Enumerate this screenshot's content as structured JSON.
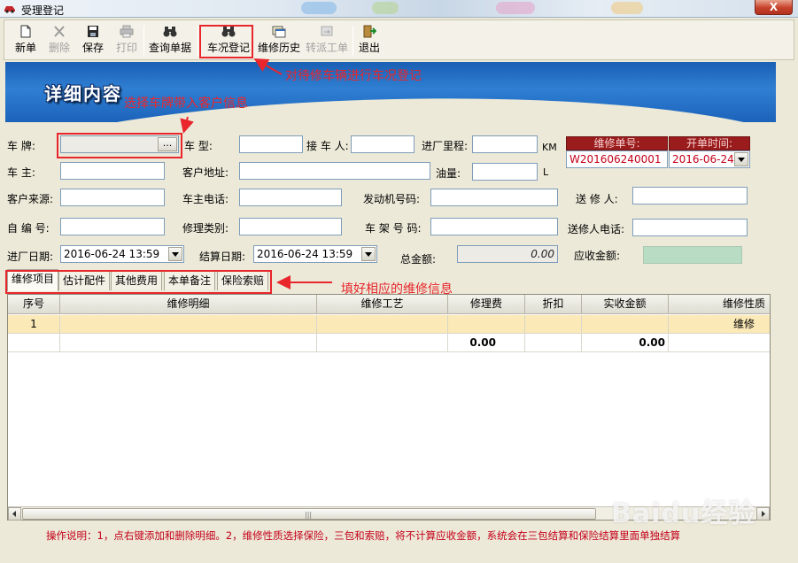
{
  "window": {
    "title": "受理登记",
    "close": "X"
  },
  "toolbar": {
    "new": "新单",
    "delete": "删除",
    "save": "保存",
    "print": "打印",
    "query": "查询单据",
    "vehicle_check": "车况登记",
    "history": "维修历史",
    "dispatch": "转派工单",
    "exit": "退出"
  },
  "banner": {
    "title": "详细内容"
  },
  "form": {
    "plate": {
      "label": "车    牌:",
      "value": "",
      "button": "..."
    },
    "model": {
      "label": "车    型:",
      "value": ""
    },
    "receiver": {
      "label": "接 车 人:",
      "value": ""
    },
    "mileage": {
      "label": "进厂里程:",
      "value": "",
      "unit": "KM"
    },
    "owner": {
      "label": "车    主:",
      "value": ""
    },
    "address": {
      "label": "客户地址:",
      "value": ""
    },
    "fuel": {
      "label": "油量:",
      "value": "",
      "unit": "L"
    },
    "source": {
      "label": "客户来源:",
      "value": ""
    },
    "owner_phone": {
      "label": "车主电话:",
      "value": ""
    },
    "engine_no": {
      "label": "发动机号码:",
      "value": ""
    },
    "sender": {
      "label": "送 修 人:",
      "value": ""
    },
    "self_no": {
      "label": "自 编 号:",
      "value": ""
    },
    "repair_type": {
      "label": "修理类别:",
      "value": ""
    },
    "frame_no": {
      "label": "车 架 号 码:",
      "value": ""
    },
    "sender_phone": {
      "label": "送修人电话:",
      "value": ""
    },
    "entry_date": {
      "label": "进厂日期:",
      "value": "2016-06-24 13:59"
    },
    "settle_date": {
      "label": "结算日期:",
      "value": "2016-06-24 13:59"
    },
    "total": {
      "label": "总金额:",
      "value": "0.00"
    },
    "receivable": {
      "label": "应收金额:",
      "value": ""
    }
  },
  "order": {
    "no_label": "维修单号:",
    "no_value": "W201606240001",
    "time_label": "开单时间:",
    "time_value": "2016-06-24"
  },
  "tabs": [
    "维修项目",
    "估计配件",
    "其他费用",
    "本单备注",
    "保险索赔"
  ],
  "grid": {
    "columns": [
      "序号",
      "维修明细",
      "维修工艺",
      "修理费",
      "折扣",
      "实收金额",
      "维修性质"
    ],
    "rows": [
      [
        "1",
        "",
        "",
        "",
        "",
        "",
        "维修"
      ],
      [
        "",
        "",
        "",
        "0.00",
        "",
        "0.00",
        ""
      ]
    ]
  },
  "instructions": "操作说明：1，点右键添加和删除明细。2，维修性质选择保险，三包和索赔，将不计算应收金额，系统会在三包结算和保险结算里面单独结算",
  "annotations": {
    "vehicle_check_note": "对待修车辆进行车况登记",
    "plate_note": "选择车牌带入客户信息",
    "tab_note": "填好相应的维修信息"
  },
  "watermark": "Baidu经验",
  "colors": {
    "accent_red": "#e8262c",
    "banner_blue": "#1a5fb4",
    "order_header": "#9b1c1c",
    "row_highlight": "#fbe9b7"
  }
}
